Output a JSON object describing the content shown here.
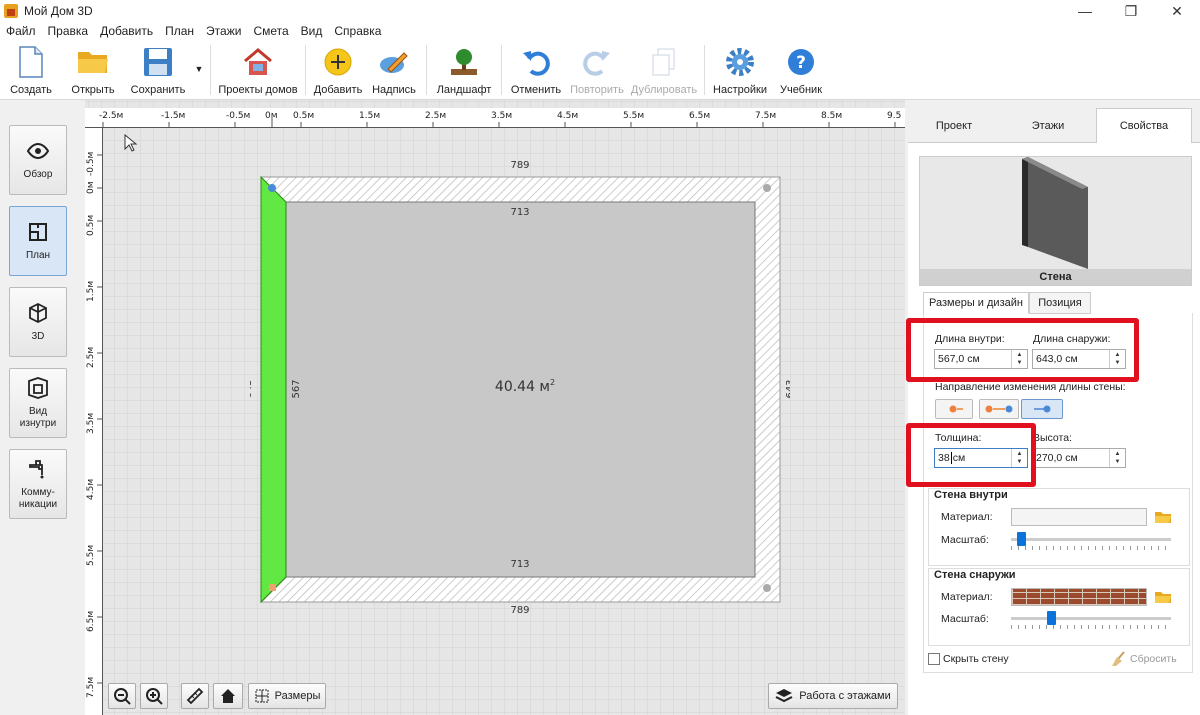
{
  "window": {
    "title": "Мой Дом 3D",
    "minimize": "—",
    "maximize": "❐",
    "close": "✕"
  },
  "menu": [
    "Файл",
    "Правка",
    "Добавить",
    "План",
    "Этажи",
    "Смета",
    "Вид",
    "Справка"
  ],
  "toolbar": {
    "create": "Создать",
    "open": "Открыть",
    "save": "Сохранить",
    "projects": "Проекты домов",
    "add": "Добавить",
    "caption": "Надпись",
    "landscape": "Ландшафт",
    "undo": "Отменить",
    "redo": "Повторить",
    "duplicate": "Дублировать",
    "settings": "Настройки",
    "tutorial": "Учебник"
  },
  "sidebar": {
    "overview": "Обзор",
    "plan": "План",
    "view3d": "3D",
    "inside_1": "Вид",
    "inside_2": "изнутри",
    "comm_1": "Комму-",
    "comm_2": "никации"
  },
  "ruler_h": [
    "-2.5м",
    "-1.5м",
    "-0.5м",
    "0м",
    "0.5м",
    "1.5м",
    "2.5м",
    "3.5м",
    "4.5м",
    "5.5м",
    "6.5м",
    "7.5м",
    "8.5м",
    "9.5"
  ],
  "ruler_v": [
    "-0.5м",
    "0м",
    "0.5м",
    "1.5м",
    "2.5м",
    "3.5м",
    "4.5м",
    "5.5м",
    "6.5м",
    "7.5м"
  ],
  "plan": {
    "top_outer": "789",
    "top_inner": "713",
    "bottom_inner": "713",
    "bottom_outer": "789",
    "left_outer": "643",
    "left_inner": "567",
    "right_outer": "643",
    "area": "40.44 м",
    "area_sup": "2"
  },
  "canvas_bottom": {
    "dimensions": "Размеры",
    "floors": "Работа с этажами"
  },
  "tabs": {
    "project": "Проект",
    "floors": "Этажи",
    "properties": "Свойства"
  },
  "preview": {
    "label": "Стена"
  },
  "subtabs": {
    "size": "Размеры и дизайн",
    "position": "Позиция"
  },
  "fields": {
    "len_in_label": "Длина внутри:",
    "len_in": "567,0 см",
    "len_out_label": "Длина снаружи:",
    "len_out": "643,0 см",
    "direction_label": "Направление изменения длины стены:",
    "thickness_label": "Толщина:",
    "thickness": "38",
    "thickness_unit": "см",
    "height_label": "Высота:",
    "height": "270,0 см"
  },
  "inner": {
    "title": "Стена внутри",
    "material": "Материал:",
    "scale": "Масштаб:",
    "scale_value": 0.06
  },
  "outer": {
    "title": "Стена снаружи",
    "material": "Материал:",
    "scale": "Масштаб:",
    "scale_value": 0.25
  },
  "footer": {
    "hide": "Скрыть стену",
    "reset": "Сбросить"
  }
}
